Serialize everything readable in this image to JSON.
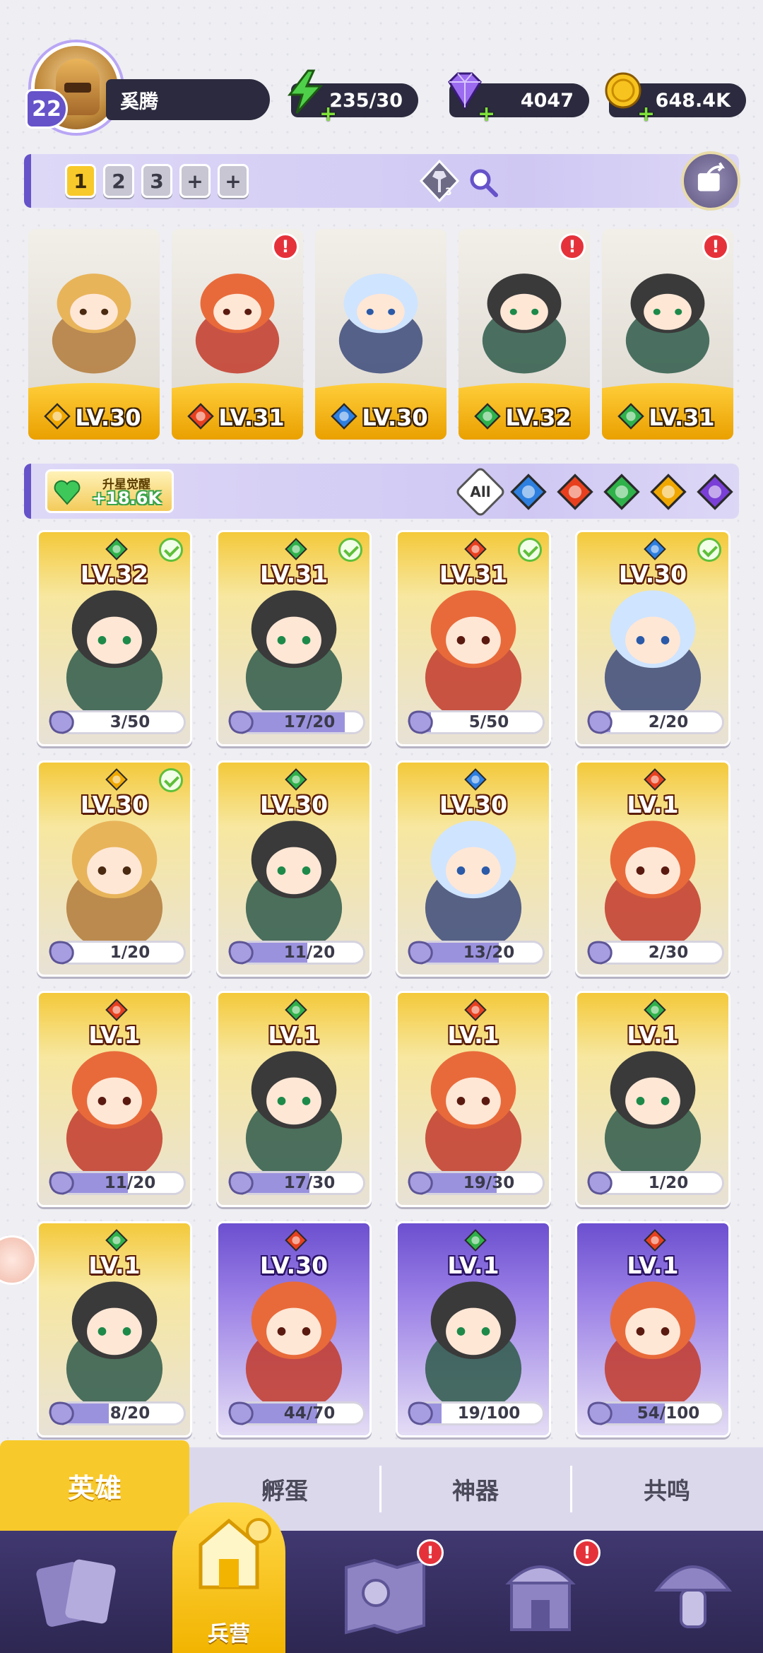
{
  "player": {
    "level": "22",
    "name": "奚腾",
    "energy": "235/30",
    "gems": "4047",
    "gold": "648.4K"
  },
  "team": {
    "slots": [
      "1",
      "2",
      "3",
      "+",
      "+"
    ],
    "active_slot": "1",
    "axe_badge": "3",
    "members": [
      {
        "level": "LV.30",
        "element": "light",
        "alert": false
      },
      {
        "level": "LV.31",
        "element": "fire",
        "alert": true
      },
      {
        "level": "LV.30",
        "element": "water",
        "alert": false
      },
      {
        "level": "LV.32",
        "element": "wind",
        "alert": true
      },
      {
        "level": "LV.31",
        "element": "wind",
        "alert": true
      }
    ]
  },
  "filter": {
    "awaken_title": "升星觉醒",
    "awaken_value": "+18.6K",
    "all_label": "All",
    "elements": [
      "water",
      "fire",
      "wind",
      "light",
      "dark"
    ]
  },
  "heroes": [
    {
      "level": "LV.32",
      "element": "wind",
      "check": true,
      "progress": "3/50",
      "fraction": 0.06,
      "frame": "gold"
    },
    {
      "level": "LV.31",
      "element": "wind",
      "check": true,
      "progress": "17/20",
      "fraction": 0.85,
      "frame": "gold"
    },
    {
      "level": "LV.31",
      "element": "fire",
      "check": true,
      "progress": "5/50",
      "fraction": 0.1,
      "frame": "gold"
    },
    {
      "level": "LV.30",
      "element": "water",
      "check": true,
      "progress": "2/20",
      "fraction": 0.1,
      "frame": "gold"
    },
    {
      "level": "LV.30",
      "element": "light",
      "check": true,
      "progress": "1/20",
      "fraction": 0.05,
      "frame": "gold"
    },
    {
      "level": "LV.30",
      "element": "wind",
      "check": false,
      "progress": "11/20",
      "fraction": 0.55,
      "frame": "gold"
    },
    {
      "level": "LV.30",
      "element": "water",
      "check": false,
      "progress": "13/20",
      "fraction": 0.65,
      "frame": "gold"
    },
    {
      "level": "LV.1",
      "element": "fire",
      "check": false,
      "progress": "2/30",
      "fraction": 0.07,
      "frame": "gold"
    },
    {
      "level": "LV.1",
      "element": "fire",
      "check": false,
      "progress": "11/20",
      "fraction": 0.55,
      "frame": "gold"
    },
    {
      "level": "LV.1",
      "element": "wind",
      "check": false,
      "progress": "17/30",
      "fraction": 0.57,
      "frame": "gold"
    },
    {
      "level": "LV.1",
      "element": "fire",
      "check": false,
      "progress": "19/30",
      "fraction": 0.63,
      "frame": "gold"
    },
    {
      "level": "LV.1",
      "element": "wind",
      "check": false,
      "progress": "1/20",
      "fraction": 0.05,
      "frame": "gold"
    },
    {
      "level": "LV.1",
      "element": "wind",
      "check": false,
      "progress": "8/20",
      "fraction": 0.4,
      "frame": "gold"
    },
    {
      "level": "LV.30",
      "element": "fire",
      "check": false,
      "progress": "44/70",
      "fraction": 0.63,
      "frame": "purple"
    },
    {
      "level": "LV.1",
      "element": "wind",
      "check": false,
      "progress": "19/100",
      "fraction": 0.19,
      "frame": "purple"
    },
    {
      "level": "LV.1",
      "element": "fire",
      "check": false,
      "progress": "54/100",
      "fraction": 0.54,
      "frame": "purple"
    }
  ],
  "subtabs": [
    "英雄",
    "孵蛋",
    "神器",
    "共鸣"
  ],
  "nav": {
    "active_label": "兵营",
    "items": [
      "cards-icon",
      "barracks-icon",
      "map-icon",
      "shrine-icon",
      "mushroom-icon"
    ]
  },
  "colors": {
    "accent": "#6652c9",
    "gold": "#f8c92a",
    "alert": "#e5323a",
    "fire": "#e8401e",
    "water": "#2d7fe0",
    "wind": "#2fb24a",
    "light": "#f0a800",
    "dark": "#7a3fd6"
  }
}
